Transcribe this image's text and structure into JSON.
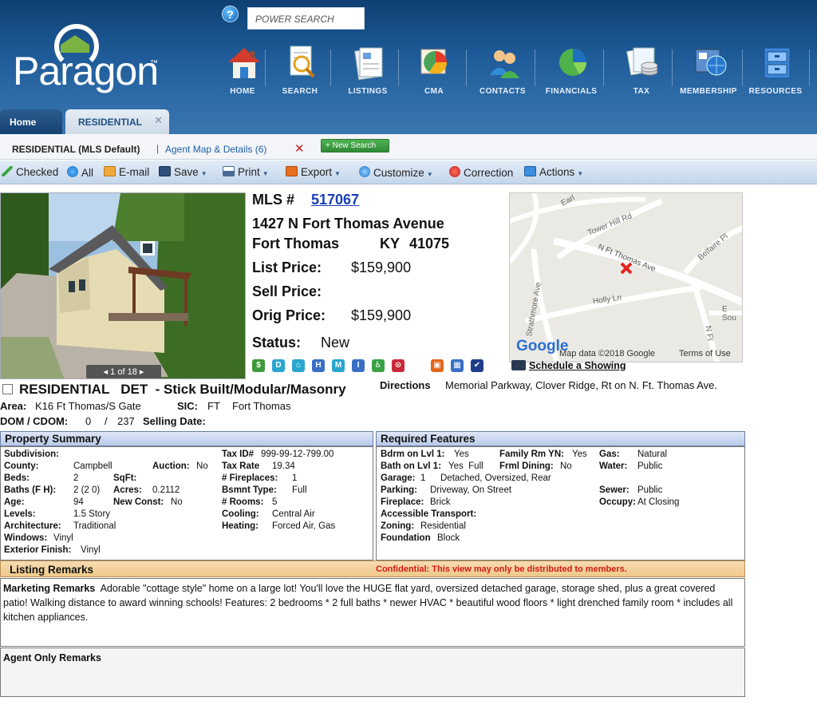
{
  "header": {
    "logo_text": "Paragon",
    "logo_tm": "™",
    "help_icon": "?",
    "search_placeholder": "POWER SEARCH",
    "nav": [
      {
        "label": "HOME",
        "icon": "home-icon"
      },
      {
        "label": "SEARCH",
        "icon": "search-document-icon"
      },
      {
        "label": "LISTINGS",
        "icon": "listings-icon"
      },
      {
        "label": "CMA",
        "icon": "cma-icon"
      },
      {
        "label": "CONTACTS",
        "icon": "contacts-icon"
      },
      {
        "label": "FINANCIALS",
        "icon": "financials-pie-icon"
      },
      {
        "label": "TAX",
        "icon": "tax-icon"
      },
      {
        "label": "MEMBERSHIP",
        "icon": "membership-icon"
      },
      {
        "label": "RESOURCES",
        "icon": "resources-icon"
      }
    ]
  },
  "tabs": {
    "home": "Home",
    "residential": "RESIDENTIAL",
    "close": "✕"
  },
  "subtabs": {
    "default": "RESIDENTIAL (MLS Default)",
    "pipe": "|",
    "agent": "Agent Map & Details (6)",
    "close": "✕",
    "new_search": "+ New Search"
  },
  "toolbar": {
    "checked": "Checked",
    "all": "All",
    "email": "E-mail",
    "save": "Save",
    "print": "Print",
    "export": "Export",
    "customize": "Customize",
    "correction": "Correction",
    "actions": "Actions",
    "dropdown": "▼"
  },
  "listing": {
    "photo_pager": "◂ 1 of 18 ▸",
    "mls_label": "MLS #",
    "mls_number": "517067",
    "address": "1427 N Fort Thomas Avenue",
    "city": "Fort Thomas",
    "state": "KY",
    "zip": "41075",
    "list_price_label": "List Price:",
    "list_price": "$159,900",
    "sell_price_label": "Sell Price:",
    "orig_price_label": "Orig Price:",
    "orig_price": "$159,900",
    "status_label": "Status:",
    "status": "New",
    "badges": [
      "$",
      "D",
      "⌂",
      "H",
      "M",
      "I",
      "♿",
      "⊙",
      "▣",
      "▦",
      "✔"
    ],
    "badge_colors": [
      "#3d9a3d",
      "#2aa6cf",
      "#2aa6cf",
      "#3a6fc5",
      "#2aa6cf",
      "#3a6fc5",
      "#3aa046",
      "#c92a3a",
      "#e0661a",
      "#3a6fc5",
      "#1d3f8a"
    ],
    "property_type": "RESIDENTIAL   DET  - Stick Built/Modular/Masonry",
    "directions_label": "Directions",
    "directions": "Memorial Parkway, Clover Ridge, Rt on N. Ft. Thomas Ave.",
    "area_label": "Area:",
    "area": "K16 Ft Thomas/S Gate",
    "sic_label": "SIC:",
    "sic_code": "FT",
    "sic_name": "Fort Thomas",
    "dom_label": "DOM / CDOM:",
    "dom": "0",
    "dom_sep": "/",
    "cdom": "237",
    "selling_date_label": "Selling Date:"
  },
  "map": {
    "streets": [
      "Earl",
      "Tower Hill Rd",
      "Belfaire Pl",
      "N Ft Thomas Ave",
      "Strathmore Ave",
      "Holly Ln",
      "E Sou",
      "N Ft"
    ],
    "google": "Google",
    "attribution": "Map data ©2018 Google",
    "terms": "Terms of Use",
    "schedule": "Schedule a Showing"
  },
  "property_summary": {
    "title": "Property Summary",
    "subdivision_label": "Subdivision:",
    "county_label": "County:",
    "county": "Campbell",
    "auction_label": "Auction:",
    "auction": "No",
    "beds_label": "Beds:",
    "beds": "2",
    "sqft_label": "SqFt:",
    "baths_label": "Baths (F H):",
    "baths": "2 (2 0)",
    "acres_label": "Acres:",
    "acres": "0.2112",
    "age_label": "Age:",
    "age": "94",
    "new_const_label": "New Const:",
    "new_const": "No",
    "levels_label": "Levels:",
    "levels": "1.5 Story",
    "architecture_label": "Architecture:",
    "architecture": "Traditional",
    "windows_label": "Windows:",
    "windows": "Vinyl",
    "exterior_label": "Exterior Finish:",
    "exterior": "Vinyl",
    "tax_id_label": "Tax ID#",
    "tax_id": "999-99-12-799.00",
    "tax_rate_label": "Tax Rate",
    "tax_rate": "19.34",
    "fireplaces_label": "# Fireplaces:",
    "fireplaces": "1",
    "bsmnt_label": "Bsmnt Type:",
    "bsmnt": "Full",
    "rooms_label": "# Rooms:",
    "rooms": "5",
    "cooling_label": "Cooling:",
    "cooling": "Central Air",
    "heating_label": "Heating:",
    "heating": "Forced Air, Gas"
  },
  "required_features": {
    "title": "Required Features",
    "bdrm_label": "Bdrm on Lvl 1:",
    "bdrm": "Yes",
    "family_label": "Family Rm YN:",
    "family": "Yes",
    "gas_label": "Gas:",
    "gas": "Natural",
    "bath_label": "Bath on Lvl 1:",
    "bath": "Yes  Full",
    "frml_label": "Frml Dining:",
    "frml": "No",
    "water_label": "Water:",
    "water": "Public",
    "garage_label": "Garage:",
    "garage": "1",
    "garage_desc": "Detached, Oversized, Rear",
    "parking_label": "Parking:",
    "parking": "Driveway, On Street",
    "sewer_label": "Sewer:",
    "sewer": "Public",
    "fireplace_label": "Fireplace:",
    "fireplace": "Brick",
    "occupy_label": "Occupy:",
    "occupy": "At Closing",
    "access_label": "Accessible Transport:",
    "zoning_label": "Zoning:",
    "zoning": "Residential",
    "foundation_label": "Foundation",
    "foundation": "Block"
  },
  "remarks": {
    "title": "Listing Remarks",
    "confidential": "Confidential: This view may only be distributed to members.",
    "marketing_label": "Marketing Remarks",
    "marketing_text": "Adorable \"cottage style\" home on a large lot! You'll love the HUGE flat yard, oversized detached garage, storage shed, plus a great covered patio! Walking distance to award winning schools! Features: 2 bedrooms * 2 full baths * newer HVAC * beautiful wood floors * light drenched family room * includes all kitchen appliances.",
    "agent_only_label": "Agent Only Remarks"
  }
}
